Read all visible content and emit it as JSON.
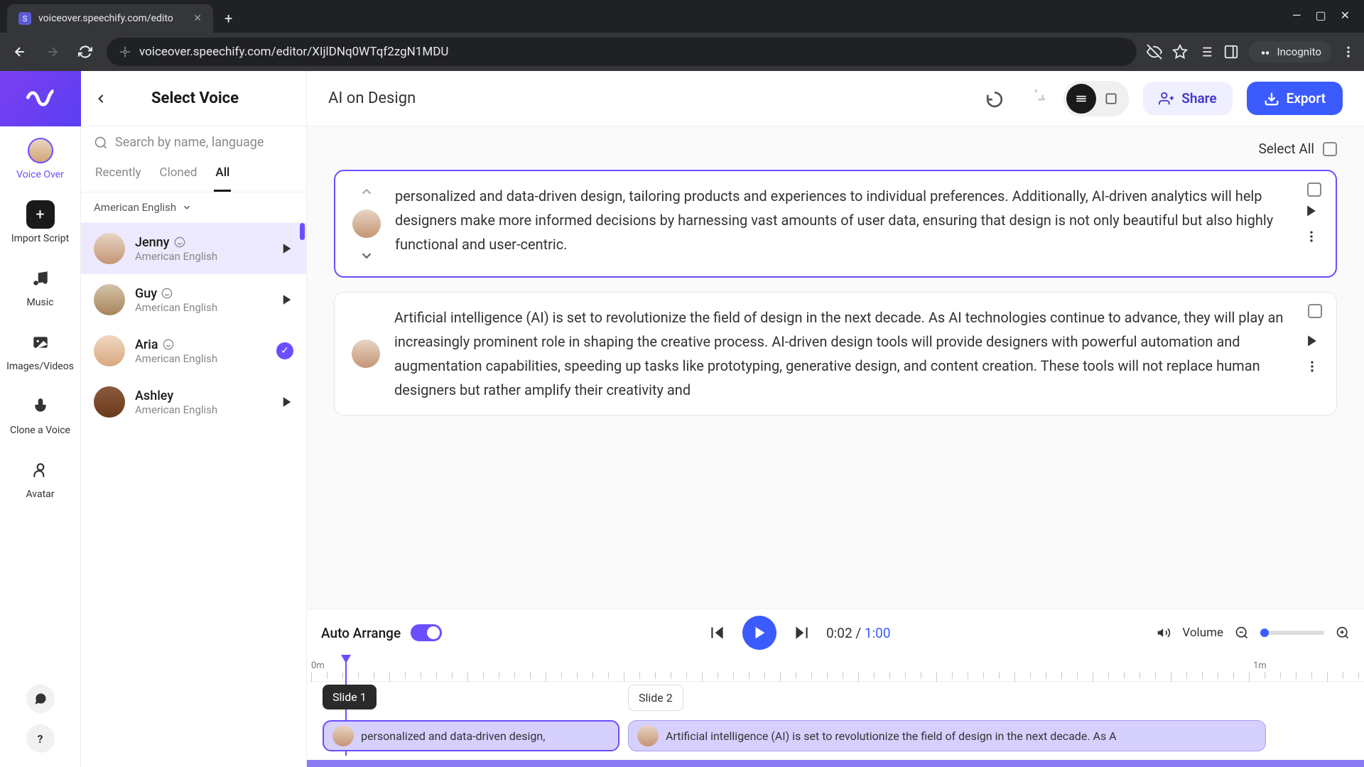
{
  "browser": {
    "tab_title": "voiceover.speechify.com/edito",
    "url": "voiceover.speechify.com/editor/XIjlDNq0WTqf2zgN1MDU",
    "incognito_label": "Incognito"
  },
  "left_rail": {
    "voice_over": "Voice Over",
    "import_script": "Import Script",
    "music": "Music",
    "images_videos": "Images/Videos",
    "clone_voice": "Clone a Voice",
    "avatar": "Avatar"
  },
  "voice_panel": {
    "title": "Select Voice",
    "search_placeholder": "Search by name, language",
    "tabs": {
      "recently": "Recently",
      "cloned": "Cloned",
      "all": "All"
    },
    "language_filter": "American English",
    "voices": [
      {
        "name": "Jenny",
        "lang": "American English",
        "selected": true,
        "checked": false
      },
      {
        "name": "Guy",
        "lang": "American English",
        "selected": false,
        "checked": false
      },
      {
        "name": "Aria",
        "lang": "American English",
        "selected": false,
        "checked": true
      },
      {
        "name": "Ashley",
        "lang": "American English",
        "selected": false,
        "checked": false
      }
    ]
  },
  "topbar": {
    "project_title": "AI on Design",
    "share": "Share",
    "export": "Export"
  },
  "content": {
    "select_all": "Select All",
    "blocks": [
      {
        "text": "personalized and data-driven design, tailoring products and experiences to individual preferences. Additionally, AI-driven analytics will help designers make more informed decisions by harnessing vast amounts of user data, ensuring that design is not only beautiful but also highly functional and user-centric.",
        "active": true
      },
      {
        "text": "Artificial intelligence (AI) is set to revolutionize the field of design in the next decade. As AI technologies continue to advance, they will play an increasingly prominent role in shaping the creative process. AI-driven design tools will provide designers with powerful automation and augmentation capabilities, speeding up tasks like prototyping, generative design, and content creation. These tools will not replace human designers but rather amplify their creativity and",
        "active": false
      }
    ]
  },
  "player": {
    "auto_arrange": "Auto Arrange",
    "current_time": "0:02",
    "total_time": "1:00",
    "volume_label": "Volume"
  },
  "timeline": {
    "marker_0": "0m",
    "marker_1": "1m",
    "slide1": "Slide 1",
    "slide2": "Slide 2",
    "clip1_text": "personalized and data-driven design,",
    "clip2_text": "Artificial intelligence (AI) is set to revolutionize the field of design in the next decade. As A"
  }
}
